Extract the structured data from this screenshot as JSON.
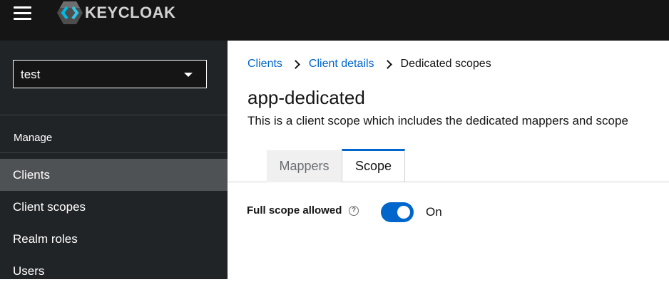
{
  "header": {
    "brand_text": "KEYCLOAK",
    "menu_icon": "hamburger-icon",
    "logo_icon": "keycloak-logo-icon"
  },
  "sidebar": {
    "realm": "test",
    "section_title": "Manage",
    "items": [
      {
        "label": "Clients",
        "active": true
      },
      {
        "label": "Client scopes",
        "active": false
      },
      {
        "label": "Realm roles",
        "active": false
      },
      {
        "label": "Users",
        "active": false
      }
    ]
  },
  "breadcrumb": {
    "items": [
      "Clients",
      "Client details",
      "Dedicated scopes"
    ]
  },
  "page": {
    "title": "app-dedicated",
    "description": "This is a client scope which includes the dedicated mappers and scope"
  },
  "tabs": [
    {
      "label": "Mappers",
      "active": false
    },
    {
      "label": "Scope",
      "active": true
    }
  ],
  "form": {
    "full_scope_label": "Full scope allowed",
    "full_scope_value": "On",
    "help_icon": "question-circle-icon"
  },
  "colors": {
    "accent": "#0066cc",
    "header_bg": "#151515",
    "sidebar_bg": "#212427",
    "nav_active_bg": "#4f5255"
  }
}
